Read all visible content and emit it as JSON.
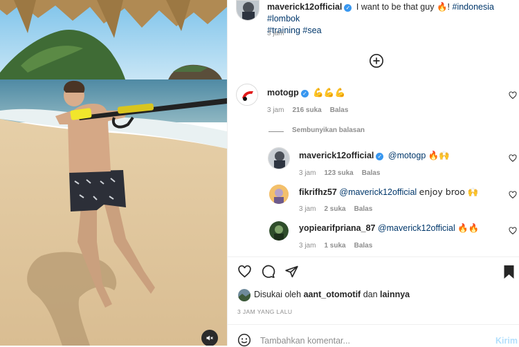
{
  "post": {
    "author": "maverick12official",
    "caption_text": "I want to be that guy",
    "caption_emoji": "🔥",
    "caption_tail": "!",
    "hashtags_line1": "#indonesia #lombok",
    "hashtags_line2": "#training #sea",
    "time": "3 jam"
  },
  "comments": [
    {
      "user": "motogp",
      "verified": true,
      "text": "💪💪💪",
      "time": "3 jam",
      "likes": "216 suka",
      "reply": "Balas"
    }
  ],
  "hide_replies_label": "Sembunyikan balasan",
  "replies": [
    {
      "user": "maverick12official",
      "verified": true,
      "mention": "@motogp",
      "text": "🔥🙌",
      "time": "3 jam",
      "likes": "123 suka",
      "reply": "Balas"
    },
    {
      "user": "fikrifhz57",
      "verified": false,
      "mention": "@maverick12official",
      "text": "enjoy broo 🙌",
      "time": "3 jam",
      "likes": "2 suka",
      "reply": "Balas"
    },
    {
      "user": "yopiearifpriana_87",
      "verified": false,
      "mention": "@maverick12official",
      "text": "🔥🔥",
      "time": "3 jam",
      "likes": "1 suka",
      "reply": "Balas"
    }
  ],
  "likes_bar": {
    "prefix": "Disukai oleh",
    "user": "aant_otomotif",
    "middle": "dan",
    "suffix": "lainnya"
  },
  "posted_ago": "3 JAM YANG LALU",
  "comment_box": {
    "placeholder": "Tambahkan komentar...",
    "send_label": "Kirim"
  },
  "icons": {
    "verified": "✓",
    "load_more": "plus-circle-icon",
    "like": "heart-icon",
    "comment": "comment-icon",
    "share": "send-icon",
    "save": "bookmark-icon",
    "mute": "muted-speaker-icon",
    "emoji": "emoji-icon"
  },
  "colors": {
    "verified": "#3897f0",
    "link": "#00376b",
    "muted_text": "#8e8e8e",
    "send_disabled": "#b2dffc"
  }
}
